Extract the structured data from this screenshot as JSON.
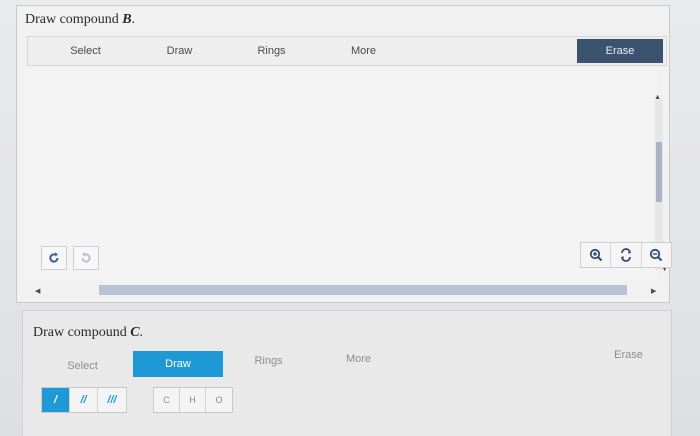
{
  "panel_b": {
    "title_prefix": "Draw compound ",
    "title_var": "B",
    "title_suffix": ".",
    "toolbar": {
      "select": "Select",
      "draw": "Draw",
      "rings": "Rings",
      "more": "More",
      "erase": "Erase"
    },
    "scroll_arrows": {
      "up": "▲",
      "down": "▼",
      "left": "◀",
      "right": "▶"
    }
  },
  "panel_c": {
    "title_prefix": "Draw compound ",
    "title_var": "C",
    "title_suffix": ".",
    "toolbar": {
      "select": "Select",
      "draw": "Draw",
      "rings": "Rings",
      "more": "More",
      "erase": "Erase"
    },
    "bonds": [
      "/",
      "//",
      "///"
    ],
    "atoms": [
      "C",
      "H",
      "O"
    ]
  },
  "colors": {
    "accent_blue": "#1e99d6",
    "erase_dark": "#3c5370",
    "scroll_thumb": "#aab4c4"
  },
  "icons": {
    "undo": "undo-icon",
    "redo": "redo-icon",
    "zoom_in": "zoom-in-icon",
    "zoom_reset": "zoom-reset-icon",
    "zoom_out": "zoom-out-icon"
  }
}
